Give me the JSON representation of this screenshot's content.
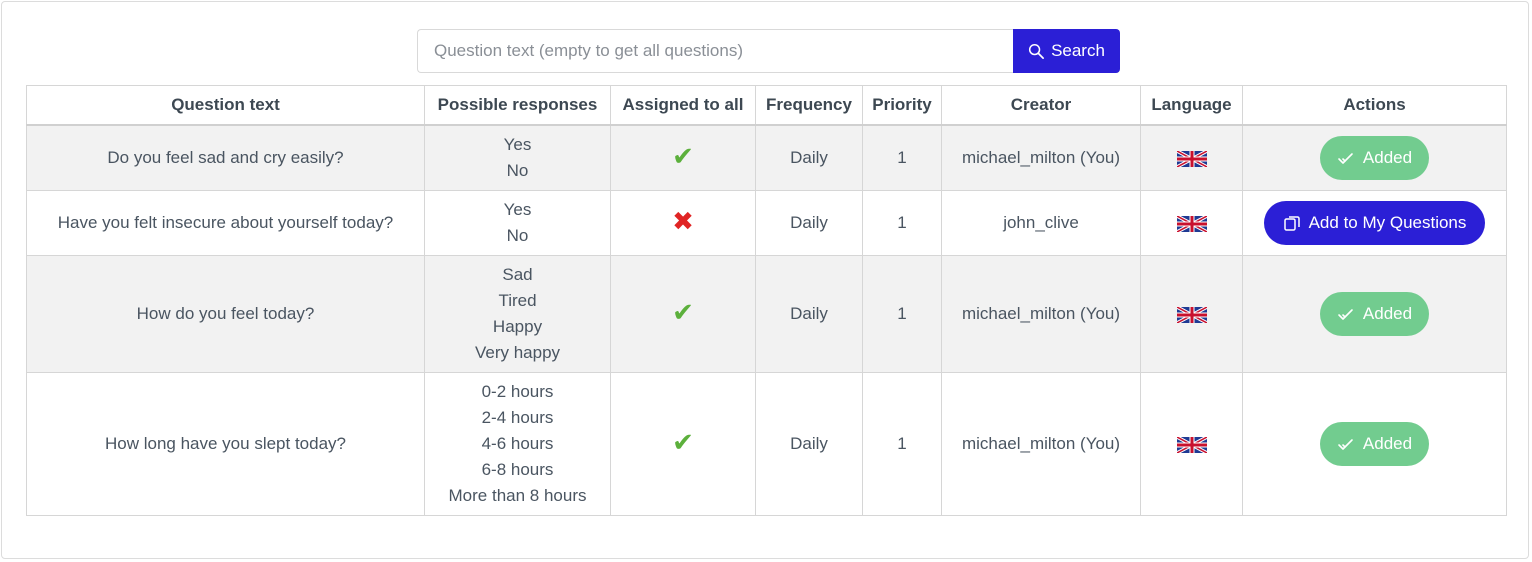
{
  "search": {
    "placeholder": "Question text (empty to get all questions)",
    "value": "",
    "button_label": "Search",
    "button_icon": "search-icon"
  },
  "table": {
    "headers": [
      "Question text",
      "Possible responses",
      "Assigned to all",
      "Frequency",
      "Priority",
      "Creator",
      "Language",
      "Actions"
    ],
    "rows": [
      {
        "question": "Do you feel sad and cry easily?",
        "responses": [
          "Yes",
          "No"
        ],
        "assigned": "✔",
        "assigned_icon": "check-icon",
        "frequency": "Daily",
        "priority": "1",
        "creator": "michael_milton (You)",
        "language_icon": "uk-flag-icon",
        "action_label": "Added",
        "action_icon": "double-check-icon"
      },
      {
        "question": "Have you felt insecure about yourself today?",
        "responses": [
          "Yes",
          "No"
        ],
        "assigned": "✖",
        "assigned_icon": "cross-icon",
        "frequency": "Daily",
        "priority": "1",
        "creator": "john_clive",
        "language_icon": "uk-flag-icon",
        "action_label": "Add to My Questions",
        "action_icon": "copy-icon"
      },
      {
        "question": "How do you feel today?",
        "responses": [
          "Sad",
          "Tired",
          "Happy",
          "Very happy"
        ],
        "assigned": "✔",
        "assigned_icon": "check-icon",
        "frequency": "Daily",
        "priority": "1",
        "creator": "michael_milton (You)",
        "language_icon": "uk-flag-icon",
        "action_label": "Added",
        "action_icon": "double-check-icon"
      },
      {
        "question": "How long have you slept today?",
        "responses": [
          "0-2 hours",
          "2-4 hours",
          "4-6 hours",
          "6-8 hours",
          "More than 8 hours"
        ],
        "assigned": "✔",
        "assigned_icon": "check-icon",
        "frequency": "Daily",
        "priority": "1",
        "creator": "michael_milton (You)",
        "language_icon": "uk-flag-icon",
        "action_label": "Added",
        "action_icon": "double-check-icon"
      }
    ]
  },
  "colors": {
    "primary": "#2b1fd6",
    "added": "#72cc8f",
    "check": "#5cb03c",
    "cross": "#e02424",
    "row_shade": "#f2f2f2"
  }
}
